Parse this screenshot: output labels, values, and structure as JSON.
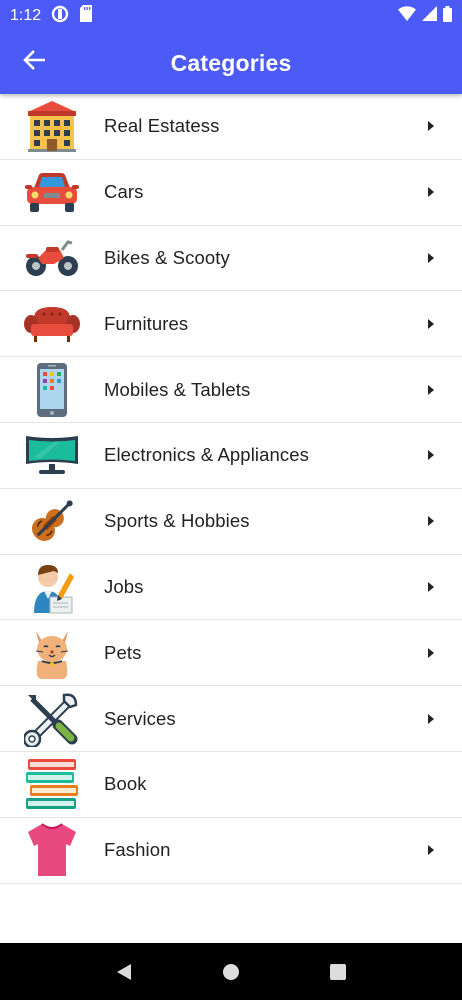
{
  "status_bar": {
    "time": "1:12",
    "icons": [
      "data-saver-icon",
      "sd-card-icon",
      "wifi-icon",
      "signal-icon",
      "battery-icon"
    ]
  },
  "header": {
    "title": "Categories",
    "back_icon": "arrow-left-icon",
    "background_color": "#4c5bf5"
  },
  "categories": [
    {
      "label": "Real Estatess",
      "icon": "building-icon",
      "has_chevron": true
    },
    {
      "label": "Cars",
      "icon": "car-icon",
      "has_chevron": true
    },
    {
      "label": "Bikes & Scooty",
      "icon": "motorbike-icon",
      "has_chevron": true
    },
    {
      "label": "Furnitures",
      "icon": "sofa-icon",
      "has_chevron": true
    },
    {
      "label": "Mobiles & Tablets",
      "icon": "smartphone-icon",
      "has_chevron": true
    },
    {
      "label": "Electronics & Appliances",
      "icon": "monitor-icon",
      "has_chevron": true
    },
    {
      "label": "Sports & Hobbies",
      "icon": "violin-icon",
      "has_chevron": true
    },
    {
      "label": "Jobs",
      "icon": "job-person-icon",
      "has_chevron": true
    },
    {
      "label": "Pets",
      "icon": "cat-icon",
      "has_chevron": true
    },
    {
      "label": "Services",
      "icon": "tools-icon",
      "has_chevron": true
    },
    {
      "label": "Book",
      "icon": "books-icon",
      "has_chevron": false
    },
    {
      "label": "Fashion",
      "icon": "tshirt-icon",
      "has_chevron": true
    }
  ],
  "nav_bar": {
    "buttons": [
      "back-triangle-icon",
      "home-circle-icon",
      "recents-square-icon"
    ]
  }
}
